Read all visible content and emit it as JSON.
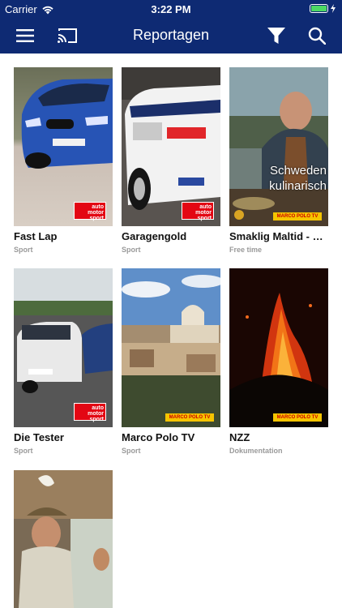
{
  "status_bar": {
    "carrier": "Carrier",
    "time": "3:22 PM",
    "battery_level": 1.0
  },
  "header": {
    "title": "Reportagen",
    "icons": [
      "menu-icon",
      "cast-icon",
      "filter-icon",
      "search-icon"
    ]
  },
  "colors": {
    "nav_bar": "#0e2a73",
    "title_text": "#111111",
    "category_text": "#9a9a9a"
  },
  "items": [
    {
      "title": "Fast Lap",
      "category": "Sport",
      "brand": "ams",
      "logo": [
        "auto",
        "motor",
        "sport"
      ]
    },
    {
      "title": "Garagengold",
      "category": "Sport",
      "brand": "ams",
      "logo": [
        "auto",
        "motor",
        "sport"
      ]
    },
    {
      "title": "Smaklig Maltid - Kulinarische Reise",
      "category": "Free time",
      "brand": "marcopolo",
      "logo": "MARCO POLO TV",
      "overlay": [
        "Schweden",
        "kulinarisch"
      ]
    },
    {
      "title": "Die Tester",
      "category": "Sport",
      "brand": "ams",
      "logo": [
        "auto",
        "motor",
        "sport"
      ]
    },
    {
      "title": "Marco Polo TV",
      "category": "Sport",
      "brand": "marcopolo",
      "logo": "MARCO POLO TV"
    },
    {
      "title": "NZZ",
      "category": "Dokumentation",
      "brand": "marcopolo",
      "logo": "MARCO POLO TV"
    },
    {
      "title": "",
      "category": "",
      "brand": ""
    }
  ]
}
